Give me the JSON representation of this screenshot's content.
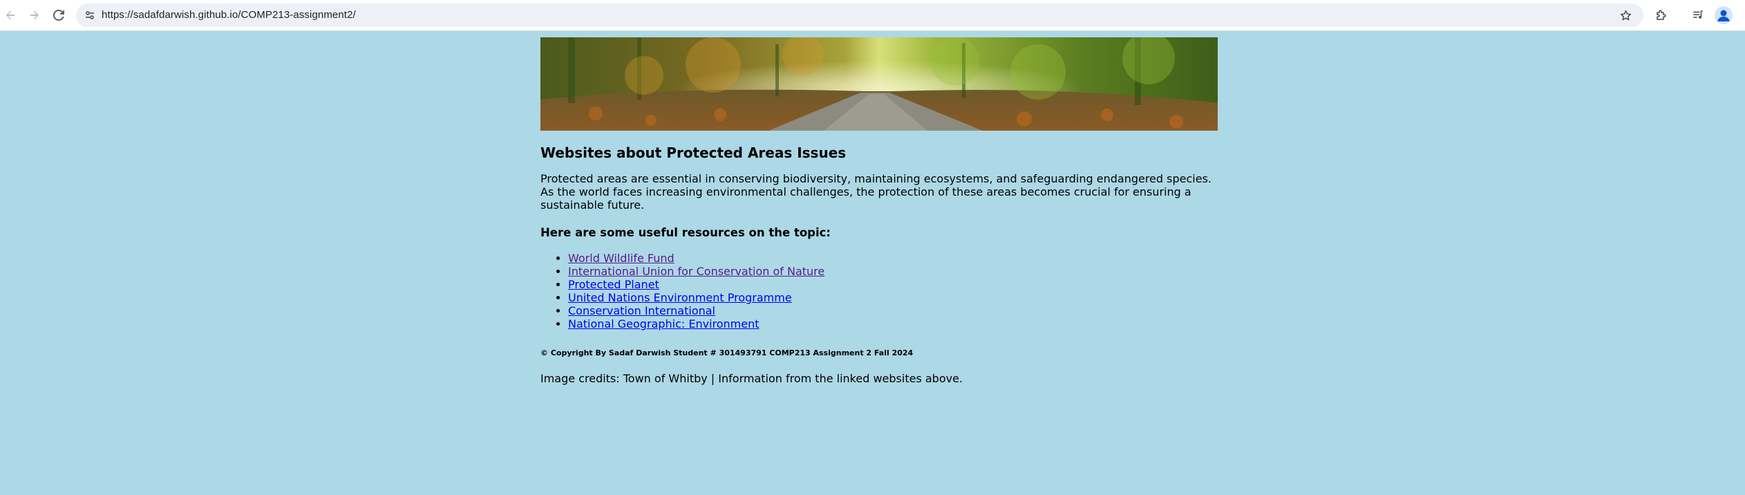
{
  "browser": {
    "url": "https://sadafdarwish.github.io/COMP213-assignment2/",
    "icons": {
      "back": "back-arrow-icon",
      "forward": "forward-arrow-icon",
      "reload": "reload-icon",
      "site_info": "site-info-icon",
      "bookmark": "star-icon",
      "extensions": "puzzle-icon",
      "media": "media-controls-icon",
      "profile": "profile-avatar-icon"
    }
  },
  "page": {
    "banner_image": "forest-path-banner",
    "heading": "Websites about Protected Areas Issues",
    "intro": "Protected areas are essential in conserving biodiversity, maintaining ecosystems, and safeguarding endangered species. As the world faces increasing environmental challenges, the protection of these areas becomes crucial for ensuring a sustainable future.",
    "resources_heading": "Here are some useful resources on the topic:",
    "links": [
      {
        "label": "World Wildlife Fund",
        "visited": true
      },
      {
        "label": "International Union for Conservation of Nature",
        "visited": true
      },
      {
        "label": "Protected Planet",
        "visited": false
      },
      {
        "label": "United Nations Environment Programme",
        "visited": false
      },
      {
        "label": "Conservation International",
        "visited": false
      },
      {
        "label": "National Geographic: Environment",
        "visited": false
      }
    ],
    "copyright": "© Copyright By Sadaf Darwish Student # 301493791 COMP213 Assignment 2 Fall 2024",
    "credits": "Image credits: Town of Whitby | Information from the linked websites above."
  },
  "colors": {
    "page_background": "#add8e6",
    "link_visited": "#551a8b",
    "link_unvisited": "#0000ee",
    "omnibox": "#edf0f7"
  }
}
